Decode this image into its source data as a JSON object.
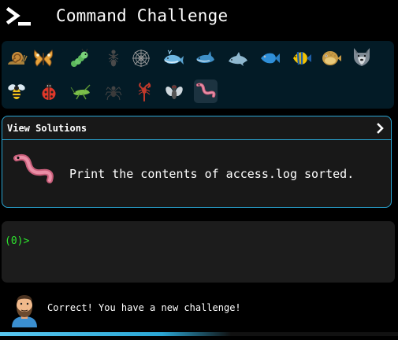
{
  "header": {
    "title": "Command Challenge",
    "logo_icon": "terminal-prompt-icon"
  },
  "tray": {
    "animals": [
      {
        "icon": "snail-icon"
      },
      {
        "icon": "butterfly-icon"
      },
      {
        "icon": "caterpillar-icon"
      },
      {
        "icon": "ant-icon"
      },
      {
        "icon": "spider-web-icon"
      },
      {
        "icon": "whale-icon"
      },
      {
        "icon": "shark-icon"
      },
      {
        "icon": "dolphin-icon"
      },
      {
        "icon": "fish-icon"
      },
      {
        "icon": "tropical-fish-icon"
      },
      {
        "icon": "blowfish-icon"
      },
      {
        "icon": "wolf-icon"
      },
      {
        "icon": "bee-icon"
      },
      {
        "icon": "ladybug-icon"
      },
      {
        "icon": "cricket-icon"
      },
      {
        "icon": "spider-icon"
      },
      {
        "icon": "scorpion-icon"
      },
      {
        "icon": "fly-icon"
      },
      {
        "icon": "worm-icon"
      }
    ]
  },
  "challenge": {
    "view_solutions_label": "View Solutions",
    "chevron_icon": "chevron-right-icon",
    "animal_icon": "worm-icon",
    "prompt": "Print the contents of access.log sorted."
  },
  "terminal": {
    "prompt": "(0)>"
  },
  "status": {
    "avatar_icon": "bearded-man-avatar",
    "message": "Correct! You have a new challenge!",
    "progress": 0.58
  },
  "colors": {
    "accent": "#2aa6d4",
    "prompt_green": "#2ee62e",
    "tray_bg": "#031b26",
    "card_bg": "#181818",
    "terminal_bg": "#1c1c1c"
  }
}
